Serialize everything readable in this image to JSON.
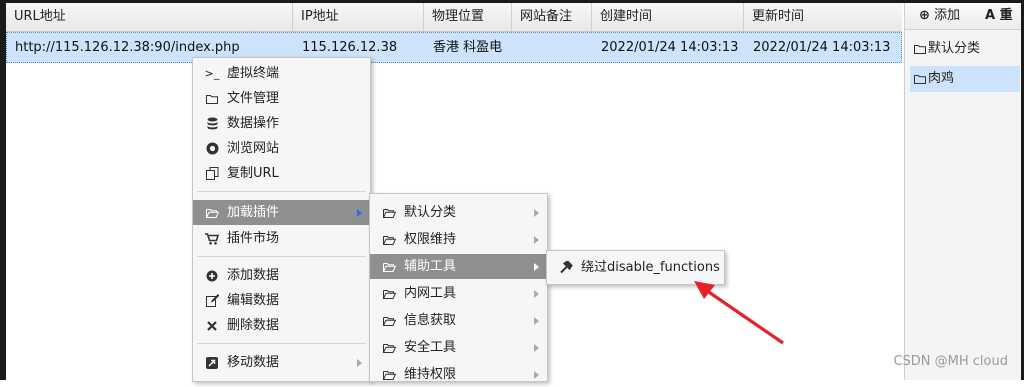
{
  "table": {
    "columns": [
      "URL地址",
      "IP地址",
      "物理位置",
      "网站备注",
      "创建时间",
      "更新时间"
    ],
    "rows": [
      {
        "url": "http://115.126.12.38:90/index.php",
        "ip": "115.126.12.38",
        "location": "香港 科盈电⁠⁠⁠",
        "note": "",
        "created": "2022/01/24 14:03:13",
        "updated": "2022/01/24 14:03:13"
      }
    ]
  },
  "side": {
    "add_label": "添加",
    "second_label": "A 重",
    "items": [
      "默认分类",
      "肉鸡"
    ]
  },
  "context_menu": {
    "items": [
      {
        "icon": "terminal-icon",
        "glyph": ">_",
        "label": "虚拟终端"
      },
      {
        "icon": "folder-icon",
        "glyph": "🗀",
        "label": "文件管理"
      },
      {
        "icon": "database-icon",
        "glyph": "≣",
        "label": "数据操作"
      },
      {
        "icon": "chrome-icon",
        "glyph": "◉",
        "label": "浏览网站"
      },
      {
        "icon": "copy-icon",
        "glyph": "⧉",
        "label": "复制URL"
      },
      {
        "icon": "folder-open-icon",
        "glyph": "🗁",
        "label": "加载插件"
      },
      {
        "icon": "cart-icon",
        "glyph": "⛟",
        "label": "插件市场"
      },
      {
        "icon": "plus-circle-icon",
        "glyph": "⊕",
        "label": "添加数据"
      },
      {
        "icon": "edit-icon",
        "glyph": "✎",
        "label": "编辑数据"
      },
      {
        "icon": "delete-icon",
        "glyph": "✖",
        "label": "删除数据"
      },
      {
        "icon": "move-icon",
        "glyph": "⇱",
        "label": "移动数据"
      }
    ]
  },
  "plugin_menu": {
    "items": [
      "默认分类",
      "权限维持",
      "辅助工具",
      "内网工具",
      "信息获取",
      "安全工具",
      "维持权限"
    ]
  },
  "tool_menu": {
    "items": [
      {
        "icon": "hammer-icon",
        "label": "绕过disable_functions"
      }
    ]
  },
  "watermark": "CSDN @MH cloud",
  "colors": {
    "selected_row": "#cce3fb",
    "menu_active": "#8f8f8f",
    "annotation_arrow": "#e8202a"
  }
}
